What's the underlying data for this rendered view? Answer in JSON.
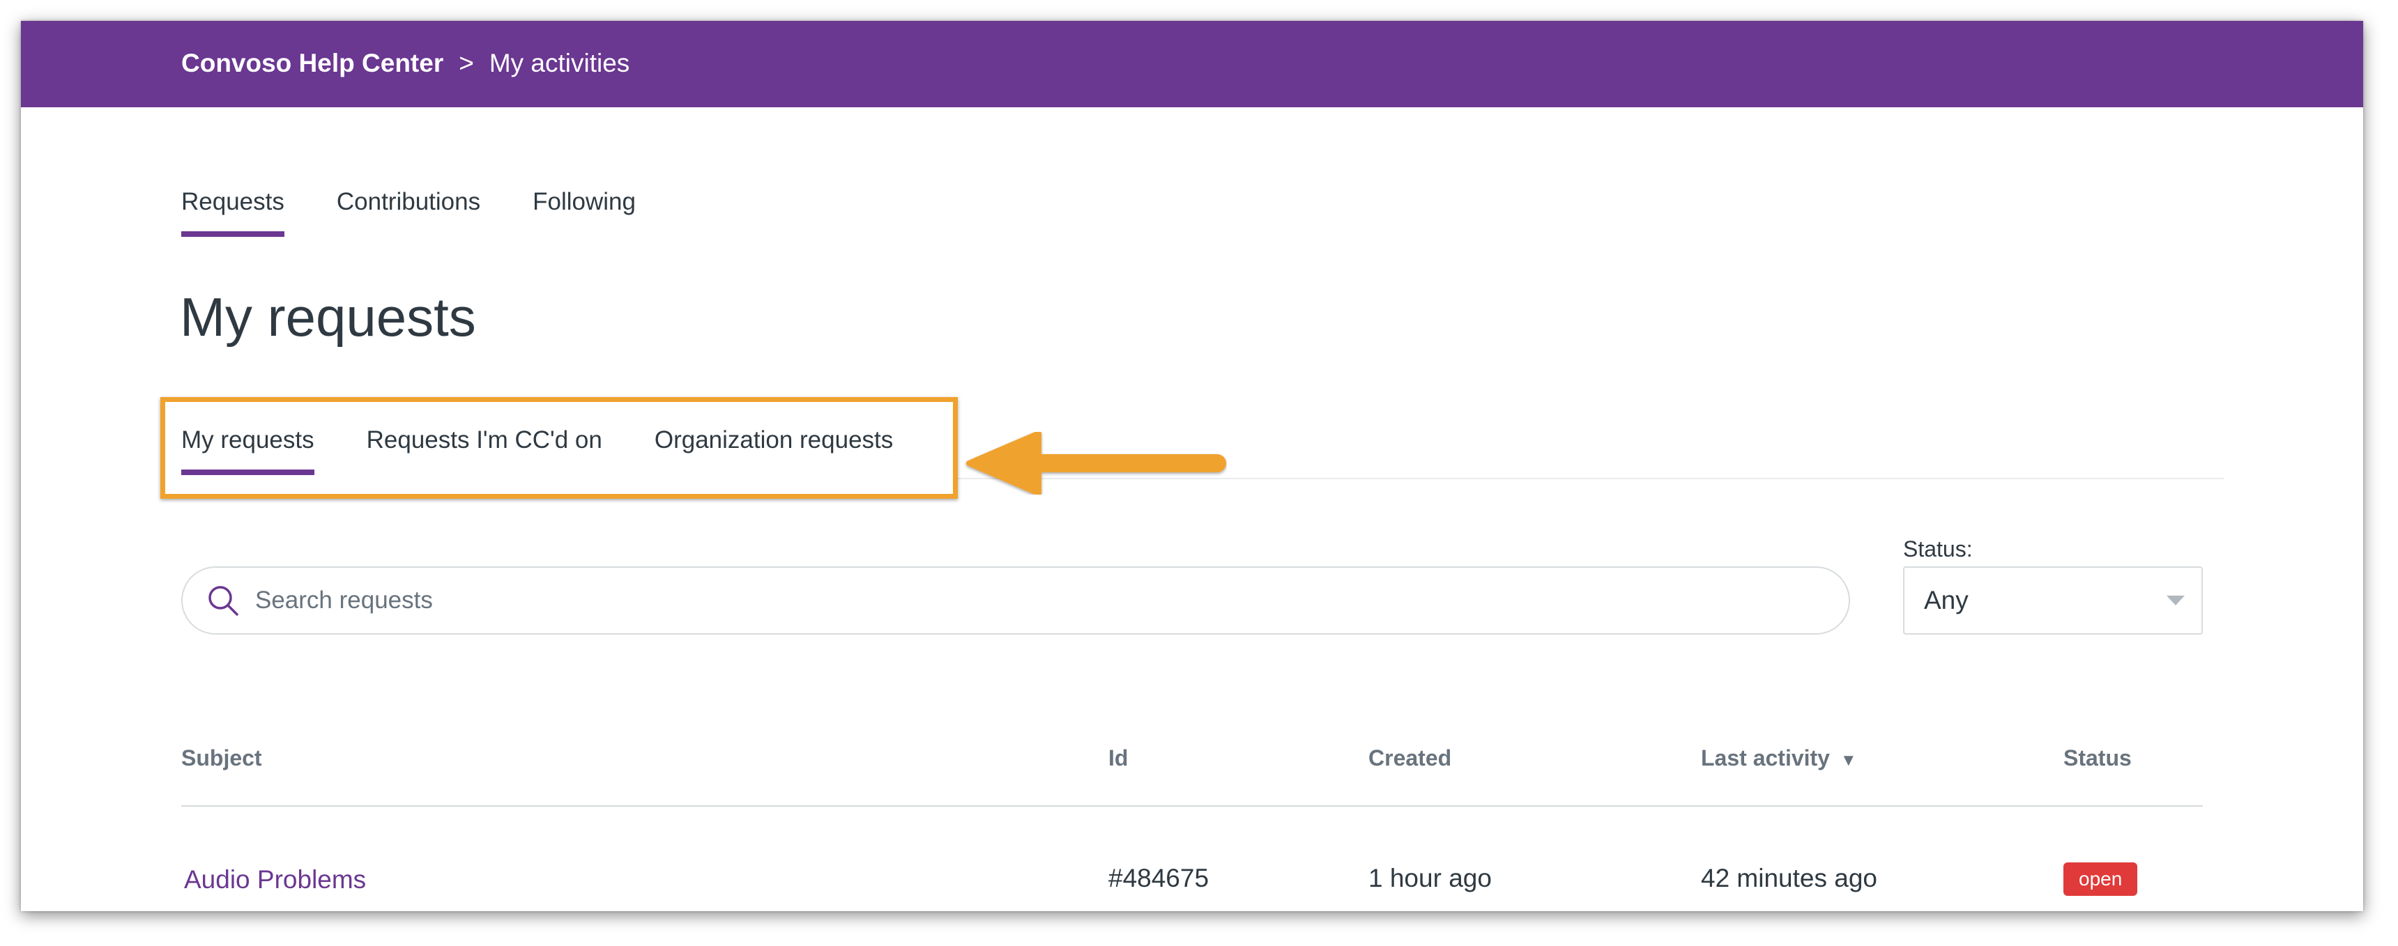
{
  "header": {
    "home_label": "Convoso Help Center",
    "separator": ">",
    "current": "My activities"
  },
  "main_tabs": [
    {
      "label": "Requests",
      "active": true
    },
    {
      "label": "Contributions",
      "active": false
    },
    {
      "label": "Following",
      "active": false
    }
  ],
  "page_title": "My requests",
  "sub_tabs": [
    {
      "label": "My requests",
      "active": true
    },
    {
      "label": "Requests I'm CC'd on",
      "active": false
    },
    {
      "label": "Organization requests",
      "active": false
    }
  ],
  "search": {
    "placeholder": "Search requests",
    "icon": "search-icon"
  },
  "status_filter": {
    "label": "Status:",
    "value": "Any"
  },
  "table": {
    "columns": {
      "subject": "Subject",
      "id": "Id",
      "created": "Created",
      "last_activity": "Last activity",
      "sort_indicator": "▼",
      "status": "Status"
    },
    "rows": [
      {
        "subject": "Audio Problems",
        "id": "#484675",
        "created": "1 hour ago",
        "last_activity": "42 minutes ago",
        "status": "open"
      }
    ]
  },
  "colors": {
    "brand": "#6a3791",
    "highlight": "#f0a22e",
    "status_open": "#e03a3a"
  }
}
